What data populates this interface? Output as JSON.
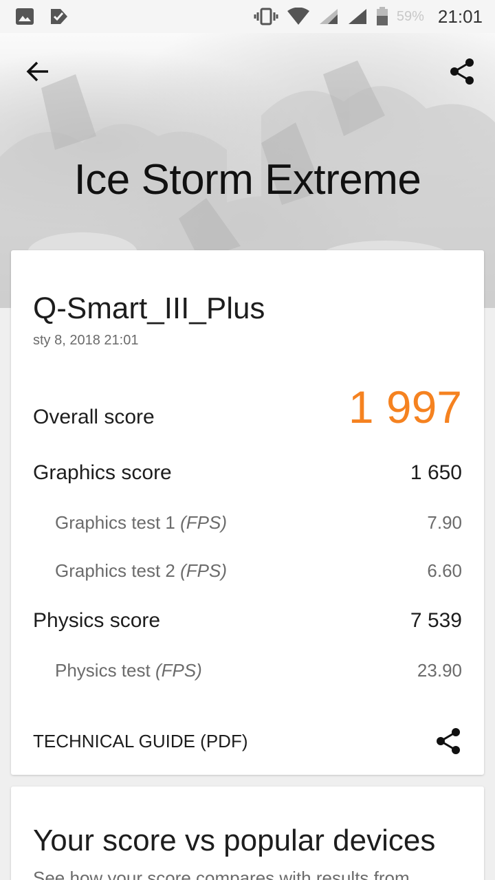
{
  "status_bar": {
    "battery_percent": "59%",
    "time": "21:01",
    "icons": [
      "image-icon",
      "check-mail-icon",
      "vibrate-icon",
      "wifi-icon",
      "signal-icon",
      "signal-icon",
      "battery-icon"
    ]
  },
  "header": {
    "title": "Ice Storm Extreme",
    "back_icon": "arrow-back-icon",
    "share_icon": "share-icon"
  },
  "result": {
    "device_name": "Q-Smart_III_Plus",
    "date": "sty 8, 2018 21:01",
    "overall_label": "Overall score",
    "overall_value": "1 997",
    "graphics_label": "Graphics score",
    "graphics_value": "1 650",
    "gt1_label": "Graphics test 1",
    "gt1_unit": "(FPS)",
    "gt1_value": "7.90",
    "gt2_label": "Graphics test 2",
    "gt2_unit": "(FPS)",
    "gt2_value": "6.60",
    "physics_label": "Physics score",
    "physics_value": "7 539",
    "pt_label": "Physics test",
    "pt_unit": "(FPS)",
    "pt_value": "23.90",
    "guide_label": "TECHNICAL GUIDE (PDF)"
  },
  "compare": {
    "title": "Your score vs popular devices",
    "description": "See how your score compares with results from"
  },
  "colors": {
    "accent": "#f58220"
  }
}
